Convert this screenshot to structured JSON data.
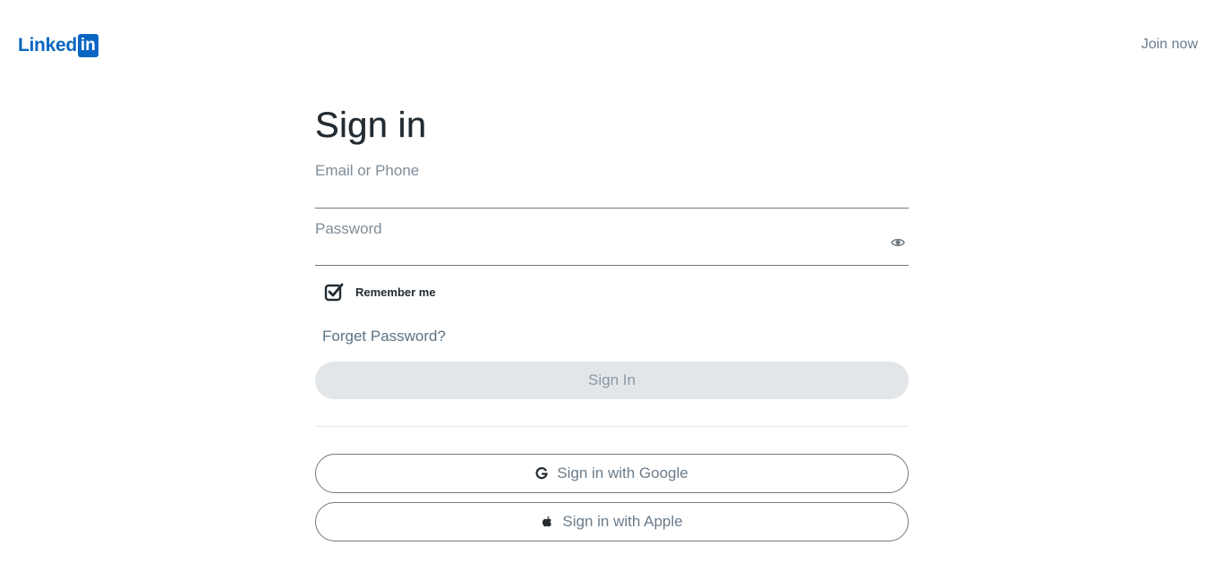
{
  "brand": {
    "logo_text": "Linked",
    "logo_box": "in"
  },
  "header": {
    "join_label": "Join now"
  },
  "form": {
    "title": "Sign in",
    "email": {
      "placeholder": "Email or Phone",
      "value": ""
    },
    "password": {
      "placeholder": "Password",
      "value": ""
    },
    "remember": {
      "label": "Remember me",
      "checked": true
    },
    "forget_label": "Forget Password?",
    "signin_label": "Sign In"
  },
  "oauth": {
    "google_label": "Sign in with Google",
    "apple_label": "Sign in with Apple"
  },
  "icons": {
    "show_password": "eye-icon",
    "remember": "checkbox-checked-icon",
    "google": "google-icon",
    "apple": "apple-icon"
  },
  "colors": {
    "brand": "#0a66c2",
    "text_dark": "#222b31",
    "text_muted": "#6b7c8b",
    "button_disabled_bg": "#e3e6e9",
    "border": "#6f7a82"
  }
}
